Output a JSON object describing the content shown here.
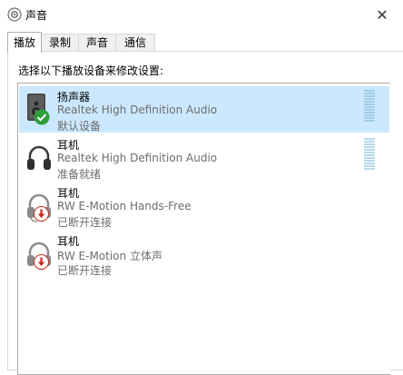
{
  "window": {
    "title": "声音",
    "close_glyph": "✕"
  },
  "tabs": [
    {
      "label": "播放",
      "active": true
    },
    {
      "label": "录制",
      "active": false
    },
    {
      "label": "声音",
      "active": false
    },
    {
      "label": "通信",
      "active": false
    }
  ],
  "instruction": "选择以下播放设备来修改设置:",
  "devices": [
    {
      "name": "扬声器",
      "description": "Realtek High Definition Audio",
      "status": "默认设备",
      "icon": "speaker-icon",
      "badge": "default-check-icon",
      "selected": true
    },
    {
      "name": "耳机",
      "description": "Realtek High Definition Audio",
      "status": "准备就绪",
      "icon": "headphones-icon",
      "badge": "",
      "selected": false
    },
    {
      "name": "耳机",
      "description": "RW E-Motion Hands-Free",
      "status": "已断开连接",
      "icon": "headset-icon",
      "badge": "disconnected-arrow-icon",
      "selected": false
    },
    {
      "name": "耳机",
      "description": "RW E-Motion 立体声",
      "status": "已断开连接",
      "icon": "headphones-icon",
      "badge": "disconnected-arrow-icon",
      "selected": false
    }
  ],
  "colors": {
    "selection": "#cce8ff",
    "check_badge": "#2e9e3a",
    "disconnect_badge": "#c42b1c",
    "meter": "#b5d9ec"
  }
}
